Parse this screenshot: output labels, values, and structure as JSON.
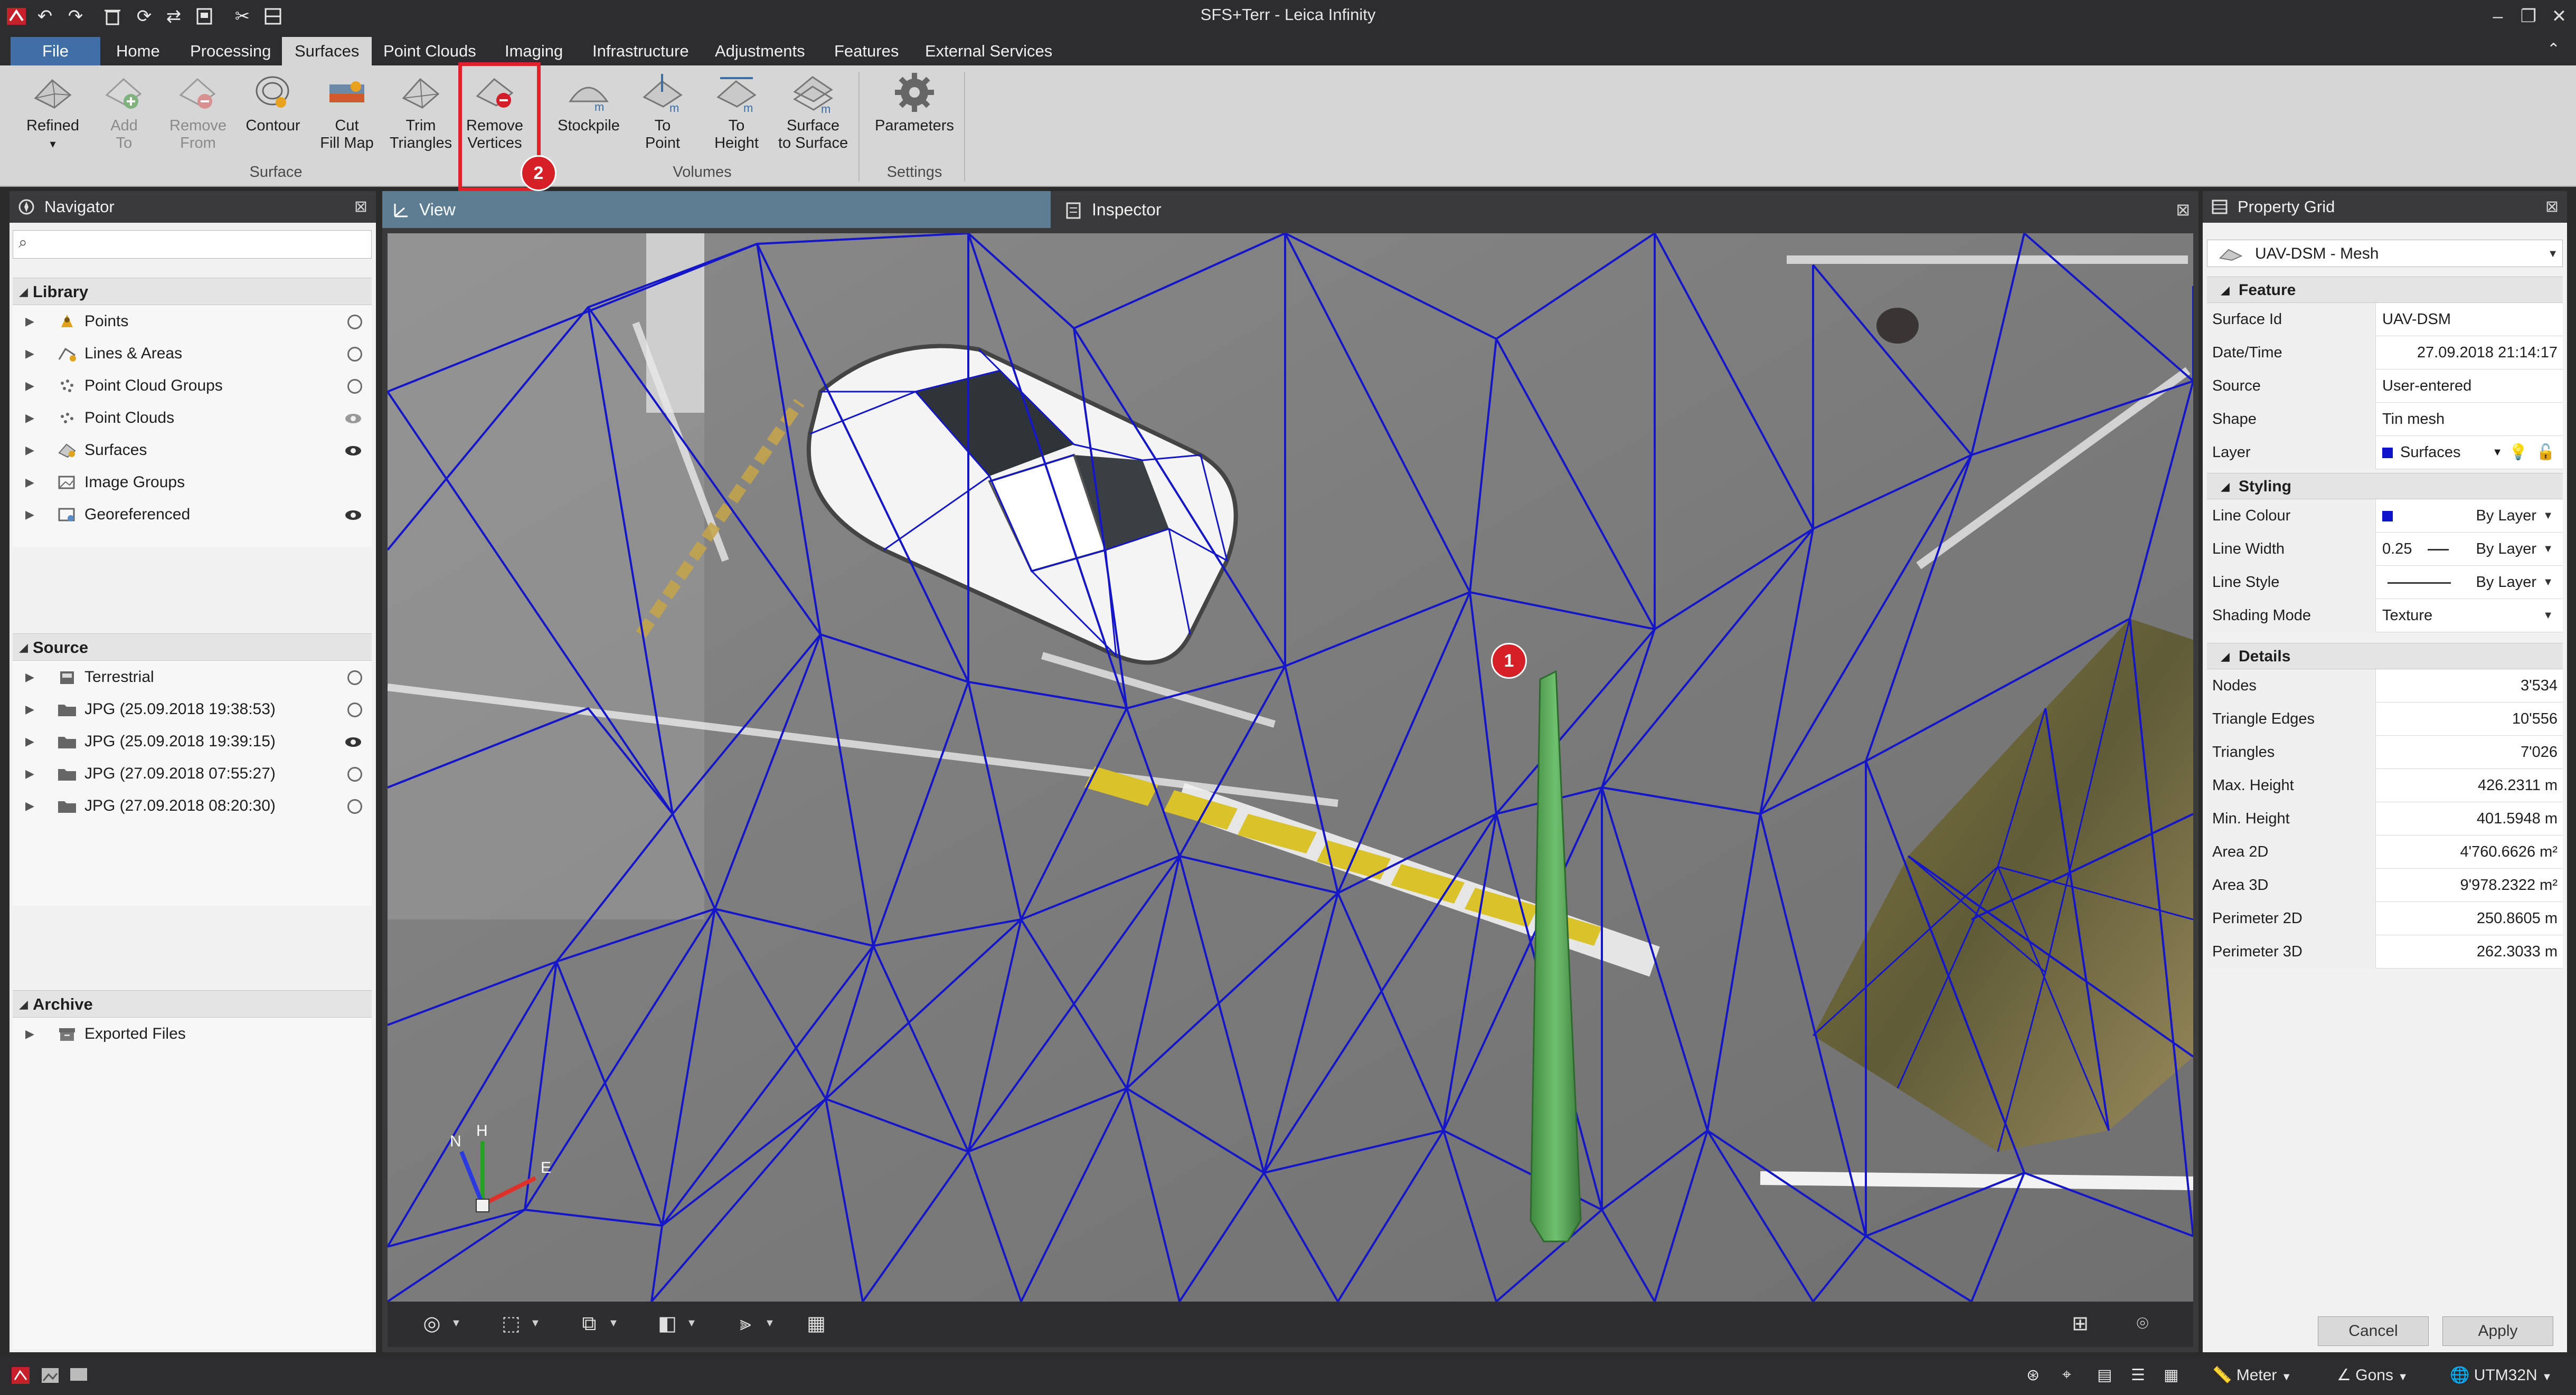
{
  "window": {
    "title": "SFS+Terr - Leica Infinity"
  },
  "ribbon_tabs": [
    "File",
    "Home",
    "Processing",
    "Surfaces",
    "Point Clouds",
    "Imaging",
    "Infrastructure",
    "Adjustments",
    "Features",
    "External Services"
  ],
  "ribbon": {
    "refined": "Refined",
    "add_to": "Add\nTo",
    "remove_from": "Remove\nFrom",
    "contour": "Contour",
    "cut_fill_map": "Cut\nFill Map",
    "trim_triangles": "Trim\nTriangles",
    "remove_vertices": "Remove\nVertices",
    "stockpile": "Stockpile",
    "to_point": "To\nPoint",
    "to_height": "To\nHeight",
    "surface_to_surface": "Surface\nto Surface",
    "parameters": "Parameters",
    "group_surface": "Surface",
    "group_volumes": "Volumes",
    "group_settings": "Settings"
  },
  "markers": {
    "one": "1",
    "two": "2"
  },
  "navigator": {
    "title": "Navigator",
    "search_placeholder": "",
    "library": {
      "title": "Library",
      "items": [
        {
          "label": "Points",
          "visibility": "off"
        },
        {
          "label": "Lines & Areas",
          "visibility": "off"
        },
        {
          "label": "Point Cloud Groups",
          "visibility": "off"
        },
        {
          "label": "Point Clouds",
          "visibility": "partial"
        },
        {
          "label": "Surfaces",
          "visibility": "on"
        },
        {
          "label": "Image Groups",
          "visibility": "none"
        },
        {
          "label": "Georeferenced",
          "visibility": "on"
        }
      ]
    },
    "source": {
      "title": "Source",
      "items": [
        {
          "label": "Terrestrial",
          "visibility": "off"
        },
        {
          "label": "JPG (25.09.2018 19:38:53)",
          "visibility": "off"
        },
        {
          "label": "JPG (25.09.2018 19:39:15)",
          "visibility": "on"
        },
        {
          "label": "JPG (27.09.2018 07:55:27)",
          "visibility": "off"
        },
        {
          "label": "JPG (27.09.2018 08:20:30)",
          "visibility": "off"
        }
      ]
    },
    "archive": {
      "title": "Archive",
      "items": [
        {
          "label": "Exported Files"
        }
      ]
    }
  },
  "view": {
    "tab": "View",
    "inspector_tab": "Inspector",
    "axis_labels": {
      "n": "N",
      "h": "H",
      "e": "E"
    }
  },
  "property_grid": {
    "title": "Property Grid",
    "selected": "UAV-DSM - Mesh",
    "feature": {
      "title": "Feature",
      "rows": [
        {
          "key": "Surface Id",
          "value": "UAV-DSM"
        },
        {
          "key": "Date/Time",
          "value": "27.09.2018 21:14:17"
        },
        {
          "key": "Source",
          "value": "User-entered"
        },
        {
          "key": "Shape",
          "value": "Tin mesh"
        },
        {
          "key": "Layer",
          "value": "Surfaces"
        }
      ]
    },
    "styling": {
      "title": "Styling",
      "line_colour_key": "Line Colour",
      "line_colour_value": "By Layer",
      "line_width_key": "Line Width",
      "line_width_num": "0.25",
      "line_width_value": "By Layer",
      "line_style_key": "Line Style",
      "line_style_value": "By Layer",
      "shading_key": "Shading Mode",
      "shading_value": "Texture"
    },
    "details": {
      "title": "Details",
      "rows": [
        {
          "key": "Nodes",
          "value": "3'534"
        },
        {
          "key": "Triangle Edges",
          "value": "10'556"
        },
        {
          "key": "Triangles",
          "value": "7'026"
        },
        {
          "key": "Max. Height",
          "value": "426.2311  m"
        },
        {
          "key": "Min. Height",
          "value": "401.5948  m"
        },
        {
          "key": "Area 2D",
          "value": "4'760.6626  m²"
        },
        {
          "key": "Area 3D",
          "value": "9'978.2322  m²"
        },
        {
          "key": "Perimeter 2D",
          "value": "250.8605  m"
        },
        {
          "key": "Perimeter 3D",
          "value": "262.3033  m"
        }
      ]
    },
    "cancel": "Cancel",
    "apply": "Apply"
  },
  "statusbar": {
    "unit": "Meter",
    "angle": "Gons",
    "crs": "UTM32N"
  },
  "colors": {
    "mesh_line": "#1416c8",
    "ribbon_bg": "#d6d6d6",
    "highlight": "#e1202a",
    "view_tab": "#5d7d92",
    "pillar": "#4e9a4e"
  }
}
